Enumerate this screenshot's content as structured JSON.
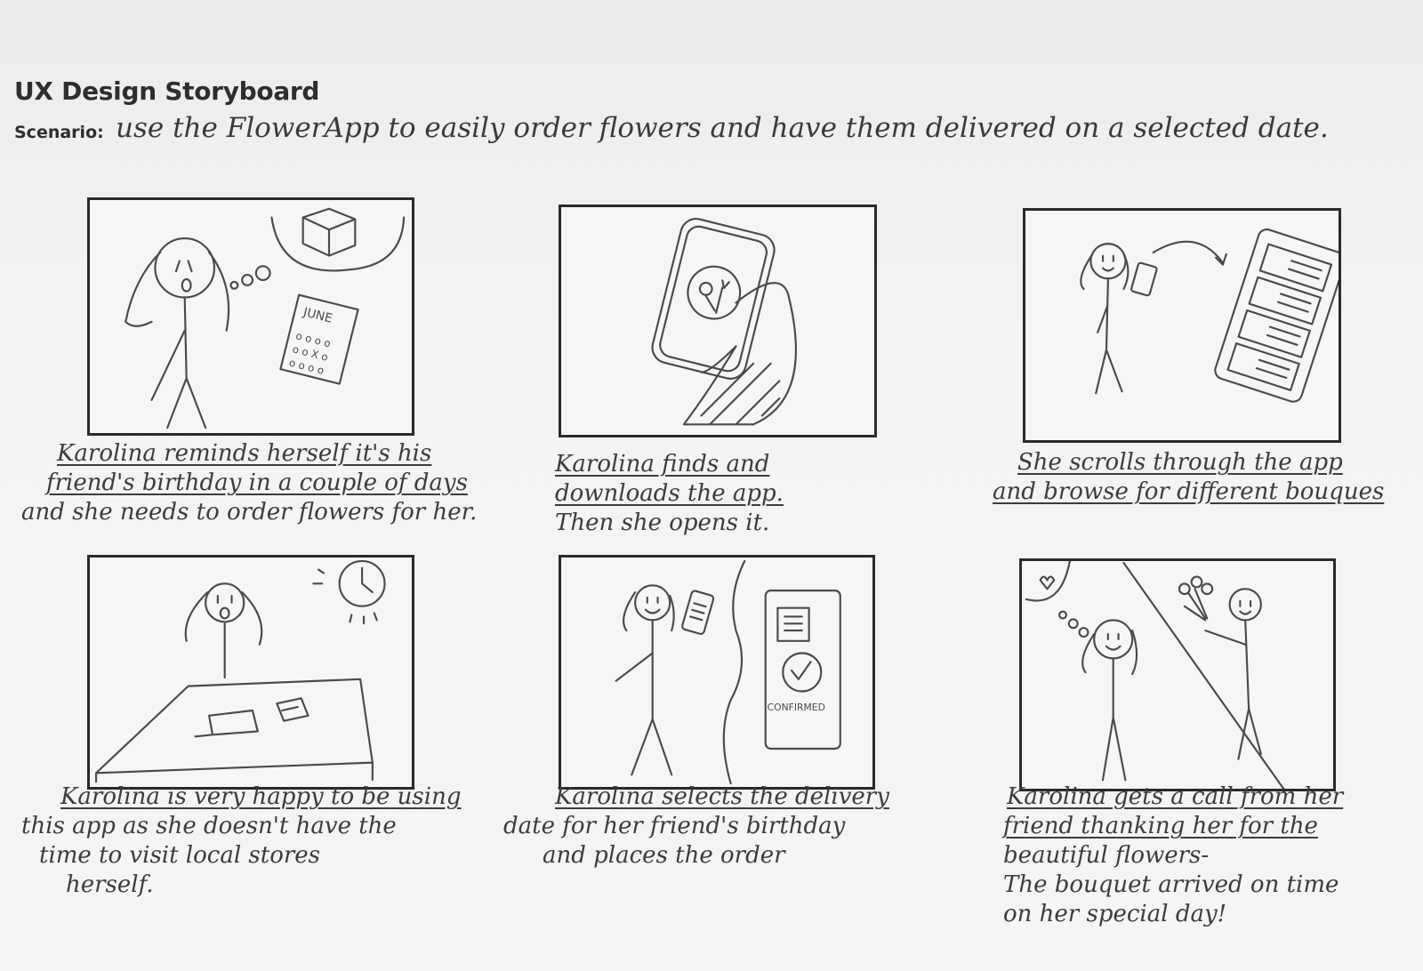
{
  "title": "UX Design Storyboard",
  "scenario": {
    "label": "Scenario:",
    "text": "use the FlowerApp to easily order flowers and have them delivered on a selected date."
  },
  "panels": [
    {
      "sketch": "calendar-gift-reminder",
      "calendar_label": "JUNE",
      "caption": [
        "Karolina reminds herself it's his",
        "friend's birthday in a couple of days",
        "and she needs to order flowers for her."
      ]
    },
    {
      "sketch": "phone-flower-app",
      "caption": [
        "Karolina finds and",
        "downloads the app.",
        "Then she opens it."
      ]
    },
    {
      "sketch": "scroll-bouquets",
      "caption": [
        "She scrolls through the app",
        "and browse for different bouques"
      ]
    },
    {
      "sketch": "busy-at-desk",
      "caption": [
        "Karolina is very happy to be using",
        "this app as she doesn't have the",
        "time to visit local stores",
        "herself."
      ]
    },
    {
      "sketch": "order-confirmed",
      "confirm_label": "CONFIRMED",
      "caption": [
        "Karolina selects the delivery",
        "date for her friend's birthday",
        "and places the order"
      ]
    },
    {
      "sketch": "thank-you-call",
      "caption": [
        "Karolina gets a call from her",
        "friend thanking her for the",
        "beautiful flowers-",
        "The bouquet arrived on time",
        "on her special day!"
      ]
    }
  ]
}
